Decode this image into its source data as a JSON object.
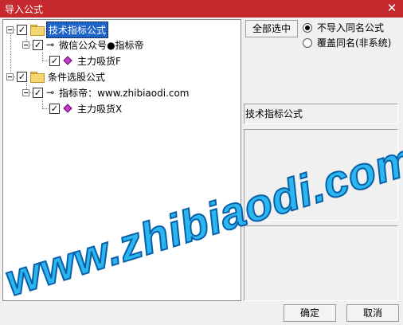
{
  "window": {
    "title": "导入公式",
    "close_glyph": "✕"
  },
  "tree": {
    "nodes": [
      {
        "label": "技术指标公式"
      },
      {
        "label": "微信公众号●指标帝"
      },
      {
        "label": "主力吸货F"
      },
      {
        "label": "条件选股公式"
      },
      {
        "label": "指标帝：www.zhibiaodi.com"
      },
      {
        "label": "主力吸货X"
      }
    ],
    "check_glyph": "✓"
  },
  "controls": {
    "select_all": "全部选中",
    "radio_skip": "不导入同名公式",
    "radio_overwrite": "覆盖同名(非系统)",
    "selected_radio": "radio_skip"
  },
  "info": {
    "category_label": "技术指标公式"
  },
  "footer": {
    "ok": "确定",
    "cancel": "取消"
  },
  "watermark": {
    "text": "www.zhibiaodi.com"
  },
  "colors": {
    "titlebar": "#c5282d",
    "selection": "#1e64c8",
    "watermark_fill": "#2ab7f0",
    "watermark_stroke": "#0a5fa8"
  }
}
